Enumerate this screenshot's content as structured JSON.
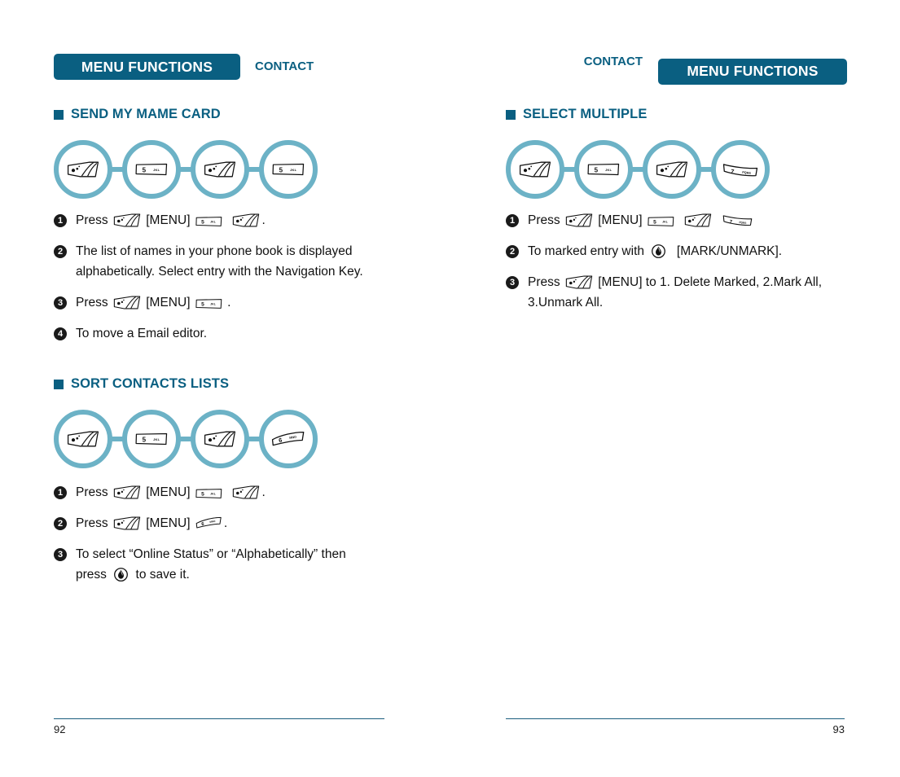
{
  "document": {
    "type": "mobile-phone-user-manual-spread"
  },
  "colors": {
    "header_bar": "#0a5f81",
    "accent_teal": "#6cb2c6",
    "heading": "#0a5f81",
    "rule": "#1b5e7e",
    "bullet": "#1a1a1a"
  },
  "left_page": {
    "header": {
      "bar_label": "MENU FUNCTIONS",
      "side_label": "CONTACT"
    },
    "sections": [
      {
        "title": "SEND MY MAME CARD",
        "flow": [
          {
            "key": "menu",
            "label": "MENU"
          },
          {
            "key": "num5",
            "label": "5",
            "letters": "JKL"
          },
          {
            "key": "menu",
            "label": "MENU"
          },
          {
            "key": "num5",
            "label": "5",
            "letters": "JKL"
          }
        ],
        "steps": [
          {
            "num": "1",
            "parts": [
              {
                "t": "text",
                "v": "Press "
              },
              {
                "t": "key",
                "v": "menu"
              },
              {
                "t": "text",
                "v": " [MENU] "
              },
              {
                "t": "key",
                "v": "num5"
              },
              {
                "t": "text",
                "v": "  "
              },
              {
                "t": "key",
                "v": "menu"
              },
              {
                "t": "text",
                "v": "."
              }
            ],
            "plain": "Press [MENU] 5 ."
          },
          {
            "num": "2",
            "parts": [
              {
                "t": "text",
                "v": "The list of names in your phone book is displayed\nalphabetically. Select entry with the Navigation Key."
              }
            ],
            "plain": "The list of names in your phone book is displayed alphabetically. Select entry with the Navigation Key."
          },
          {
            "num": "3",
            "parts": [
              {
                "t": "text",
                "v": "Press "
              },
              {
                "t": "key",
                "v": "menu"
              },
              {
                "t": "text",
                "v": " [MENU] "
              },
              {
                "t": "key",
                "v": "num5"
              },
              {
                "t": "text",
                "v": " ."
              }
            ],
            "plain": "Press [MENU] 5 ."
          },
          {
            "num": "4",
            "parts": [
              {
                "t": "text",
                "v": "To move a Email editor."
              }
            ],
            "plain": "To move a Email editor."
          }
        ]
      },
      {
        "title": "SORT CONTACTS LISTS",
        "flow": [
          {
            "key": "menu",
            "label": "MENU"
          },
          {
            "key": "num5",
            "label": "5",
            "letters": "JKL"
          },
          {
            "key": "menu",
            "label": "MENU"
          },
          {
            "key": "num6",
            "label": "6",
            "letters": "MNO"
          }
        ],
        "steps": [
          {
            "num": "1",
            "parts": [
              {
                "t": "text",
                "v": "Press "
              },
              {
                "t": "key",
                "v": "menu"
              },
              {
                "t": "text",
                "v": " [MENU] "
              },
              {
                "t": "key",
                "v": "num5"
              },
              {
                "t": "text",
                "v": "  "
              },
              {
                "t": "key",
                "v": "menu"
              },
              {
                "t": "text",
                "v": "."
              }
            ],
            "plain": "Press [MENU] 5 ."
          },
          {
            "num": "2",
            "parts": [
              {
                "t": "text",
                "v": "Press "
              },
              {
                "t": "key",
                "v": "menu"
              },
              {
                "t": "text",
                "v": " [MENU] "
              },
              {
                "t": "key",
                "v": "num6"
              },
              {
                "t": "text",
                "v": "."
              }
            ],
            "plain": "Press [MENU] 6 ."
          },
          {
            "num": "3",
            "parts": [
              {
                "t": "text",
                "v": "To select “Online Status” or “Alphabetically” then\npress "
              },
              {
                "t": "key",
                "v": "ok"
              },
              {
                "t": "text",
                "v": " to save it."
              }
            ],
            "plain": "To select “Online Status” or “Alphabetically” then press  to save it."
          }
        ]
      }
    ],
    "page_number": "92"
  },
  "right_page": {
    "header": {
      "bar_label": "MENU FUNCTIONS",
      "side_label": "CONTACT"
    },
    "sections": [
      {
        "title": "SELECT MULTIPLE",
        "flow": [
          {
            "key": "menu",
            "label": "MENU"
          },
          {
            "key": "num5",
            "label": "5",
            "letters": "JKL"
          },
          {
            "key": "menu",
            "label": "MENU"
          },
          {
            "key": "num7",
            "label": "7",
            "letters": "PQRS"
          }
        ],
        "steps": [
          {
            "num": "1",
            "parts": [
              {
                "t": "text",
                "v": "Press "
              },
              {
                "t": "key",
                "v": "menu"
              },
              {
                "t": "text",
                "v": " [MENU] "
              },
              {
                "t": "key",
                "v": "num5"
              },
              {
                "t": "text",
                "v": "  "
              },
              {
                "t": "key",
                "v": "menu"
              },
              {
                "t": "text",
                "v": "  "
              },
              {
                "t": "key",
                "v": "num7"
              }
            ],
            "plain": "Press [MENU] 5   7"
          },
          {
            "num": "2",
            "parts": [
              {
                "t": "text",
                "v": "To marked entry with "
              },
              {
                "t": "key",
                "v": "ok"
              },
              {
                "t": "text",
                "v": "  [MARK/UNMARK]."
              }
            ],
            "plain": "To marked entry with  [MARK/UNMARK]."
          },
          {
            "num": "3",
            "parts": [
              {
                "t": "text",
                "v": "Press "
              },
              {
                "t": "key",
                "v": "menu"
              },
              {
                "t": "text",
                "v": " [MENU] to 1. Delete Marked, 2.Mark All,\n3.Unmark All."
              }
            ],
            "plain": "Press [MENU] to 1. Delete Marked, 2.Mark All, 3.Unmark All."
          }
        ]
      }
    ],
    "page_number": "93"
  },
  "key_glyphs": {
    "menu": {
      "name": "menu-soft-key",
      "dots": 3
    },
    "num5": {
      "name": "number-key-5",
      "digit": "5",
      "letters": "JKL"
    },
    "num6": {
      "name": "number-key-6",
      "digit": "6",
      "letters": "MNO"
    },
    "num7": {
      "name": "number-key-7",
      "digit": "7",
      "letters": "PQRS"
    },
    "ok": {
      "name": "ok-center-key"
    }
  }
}
